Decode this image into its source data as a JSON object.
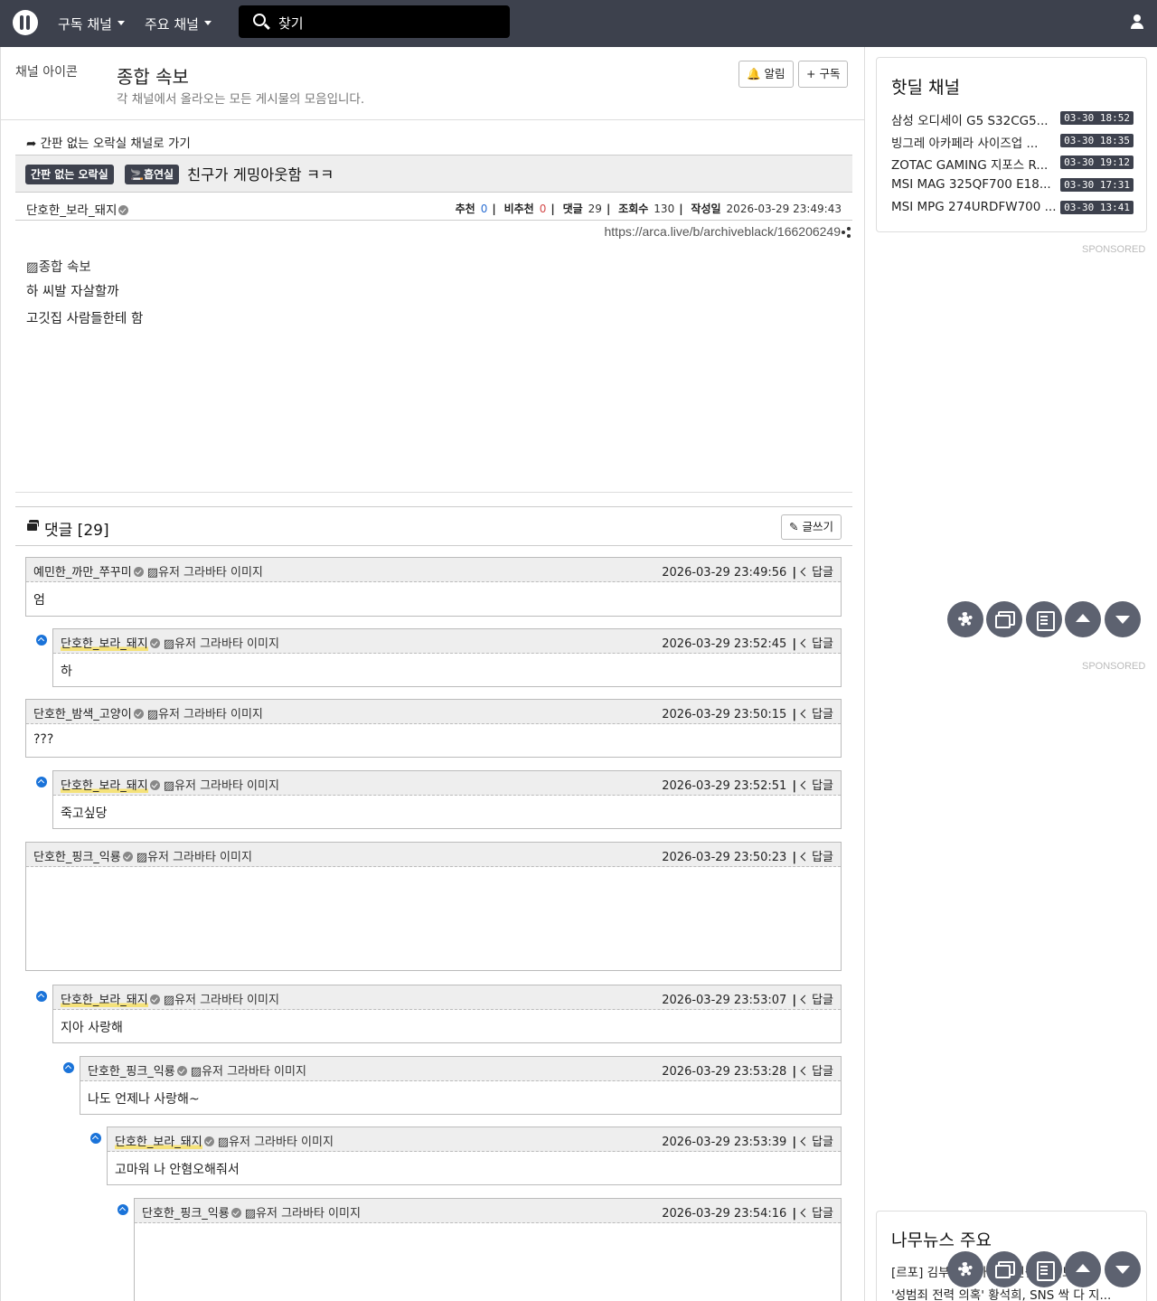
{
  "nav": {
    "subscribed": "구독 채널",
    "main_channels": "주요 채널",
    "search_placeholder": "찾기"
  },
  "channel": {
    "icon_alt": "채널 아이콘",
    "title": "종합 속보",
    "description": "각 채널에서 올라오는 모든 게시물의 모음입니다.",
    "alert_label": "🔔 알림",
    "subscribe_label": "+ 구독"
  },
  "post": {
    "goto_label": "➦ 간판 없는 오락실 채널로 가기",
    "board_badge": "간판 없는 오락실",
    "category_badge": "🚬흡연실",
    "title": "친구가 게밍아웃함 ㅋㅋ",
    "author": "단호한_보라_돼지",
    "stats": {
      "up_label": "추천",
      "up": "0",
      "down_label": "비추천",
      "down": "0",
      "comments_label": "댓글",
      "comments": "29",
      "views_label": "조회수",
      "views": "130",
      "date_label": "작성일",
      "date": "2026-03-29 23:49:43"
    },
    "url": "https://arca.live/b/archiveblack/166206249",
    "image_alt": "종합 속보",
    "lines": [
      "하 씨발 자살할까",
      "고깃집 사람들한테 함"
    ]
  },
  "comments_section": {
    "title": "댓글 [29]",
    "write_label": "글쓰기",
    "reply_label": "답글",
    "avatar_alt": "유저 그라바타 이미지",
    "items": [
      {
        "author": "예민한_까만_쭈꾸미",
        "time": "2026-03-29 23:49:56",
        "text": "엄"
      },
      {
        "author": "단호한_보라_돼지",
        "time": "2026-03-29 23:52:45",
        "text": "하"
      },
      {
        "author": "단호한_밤색_고양이",
        "time": "2026-03-29 23:50:15",
        "text": "???"
      },
      {
        "author": "단호한_보라_돼지",
        "time": "2026-03-29 23:52:51",
        "text": "죽고싶당"
      },
      {
        "author": "단호한_핑크_익룡",
        "time": "2026-03-29 23:50:23",
        "text": ""
      },
      {
        "author": "단호한_보라_돼지",
        "time": "2026-03-29 23:53:07",
        "text": "지아 사랑해"
      },
      {
        "author": "단호한_핑크_익룡",
        "time": "2026-03-29 23:53:28",
        "text": "나도 언제나 사랑해~"
      },
      {
        "author": "단호한_보라_돼지",
        "time": "2026-03-29 23:53:39",
        "text": "고마워 나 안혐오해줘서"
      },
      {
        "author": "단호한_핑크_익룡",
        "time": "2026-03-29 23:54:16",
        "text": ""
      }
    ]
  },
  "sidebar": {
    "hotdeal_title": "핫딜 채널",
    "deals": [
      {
        "name": "삼성 오디세이 G5 S32CG5...",
        "time": "03-30 18:52"
      },
      {
        "name": "빙그레 아카페라 사이즈업 ...",
        "time": "03-30 18:35"
      },
      {
        "name": "ZOTAC GAMING 지포스 R...",
        "time": "03-30 19:12"
      },
      {
        "name": "MSI MAG 325QF700 E18...",
        "time": "03-30 17:31"
      },
      {
        "name": "MSI MPG 274URDFW700 ...",
        "time": "03-30 13:41"
      }
    ],
    "sponsored": "SPONSORED",
    "news_title": "나무뉴스 주요",
    "news": [
      "[르포] 김부겸 출마 대구민심 들어보니...",
      "'성범죄 전력 의혹' 황석희, SNS 싹 다 지..."
    ]
  },
  "colors": {
    "nav_bg": "#3d414d",
    "accent_blue": "#1a73d9",
    "fab_bg": "#5d6270"
  }
}
